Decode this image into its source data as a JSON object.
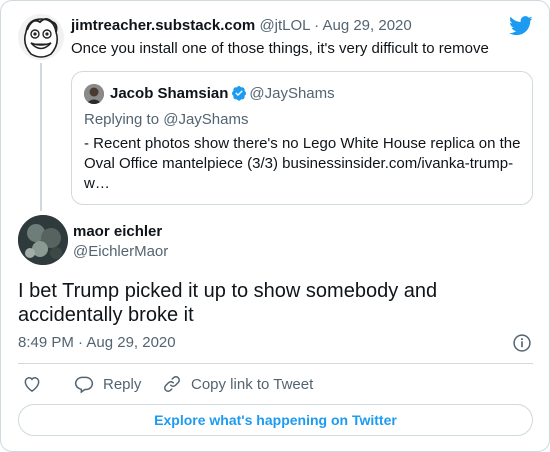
{
  "colors": {
    "accent": "#1d9bf0",
    "muted": "#536471",
    "text": "#0f1419",
    "border": "#cfd9de"
  },
  "parent": {
    "name": "jimtreacher.substack.com",
    "handle": "@jtLOL",
    "separator": "·",
    "date": "Aug 29, 2020",
    "text": "Once you install one of those things, it's very difficult to remove"
  },
  "quote": {
    "name": "Jacob Shamsian",
    "handle": "@JayShams",
    "replying": "Replying to @JayShams",
    "text": "- Recent photos show there's no Lego White House replica on the Oval Office mantelpiece (3/3) businessinsider.com/ivanka-trump-w…"
  },
  "tweet": {
    "name": "maor eichler",
    "handle": "@EichlerMaor",
    "text": "I bet Trump picked it up to show somebody and accidentally broke it",
    "timestamp": "8:49 PM · Aug 29, 2020"
  },
  "actions": {
    "reply": "Reply",
    "copy": "Copy link to Tweet"
  },
  "explore": "Explore what's happening on Twitter",
  "icons": [
    "twitter-bird-icon",
    "verified-badge-icon",
    "info-icon",
    "heart-icon",
    "reply-icon",
    "link-icon"
  ]
}
